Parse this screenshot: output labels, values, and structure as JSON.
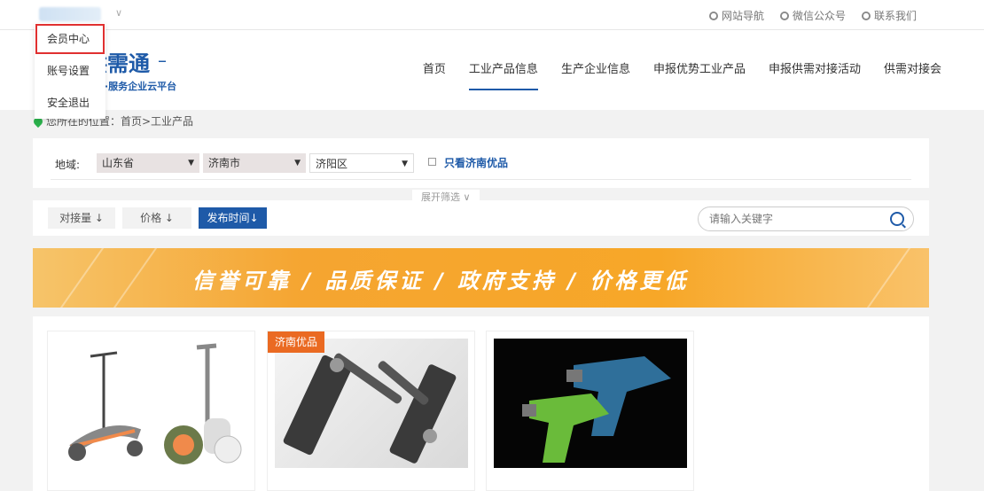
{
  "topbar": {
    "links": [
      "网站导航",
      "微信公众号",
      "联系我们"
    ]
  },
  "dropdown": {
    "items": [
      "会员中心",
      "账号设置",
      "安全退出"
    ]
  },
  "header": {
    "logo_title": "供需通",
    "logo_dash": "–",
    "logo_subtitle": "·服务企业云平台",
    "nav": [
      "首页",
      "工业产品信息",
      "生产企业信息",
      "申报优势工业产品",
      "申报供需对接活动",
      "供需对接会"
    ],
    "active_nav": "工业产品信息"
  },
  "breadcrumb": {
    "text": "您所在的位置：首页>工业产品"
  },
  "filter": {
    "label": "地域:",
    "province": "山东省",
    "city": "济南市",
    "district": "济阳区",
    "checkbox_label": "只看济南优品",
    "expand": "展开筛选 ∨"
  },
  "sort": {
    "buttons": [
      "对接量 ↓",
      "价格 ↓",
      "发布时间↓"
    ],
    "search_placeholder": "请输入关键字"
  },
  "banner": {
    "text": "信誉可靠 / 品质保证 / 政府支持 / 价格更低"
  },
  "products": {
    "badge": "济南优品"
  }
}
